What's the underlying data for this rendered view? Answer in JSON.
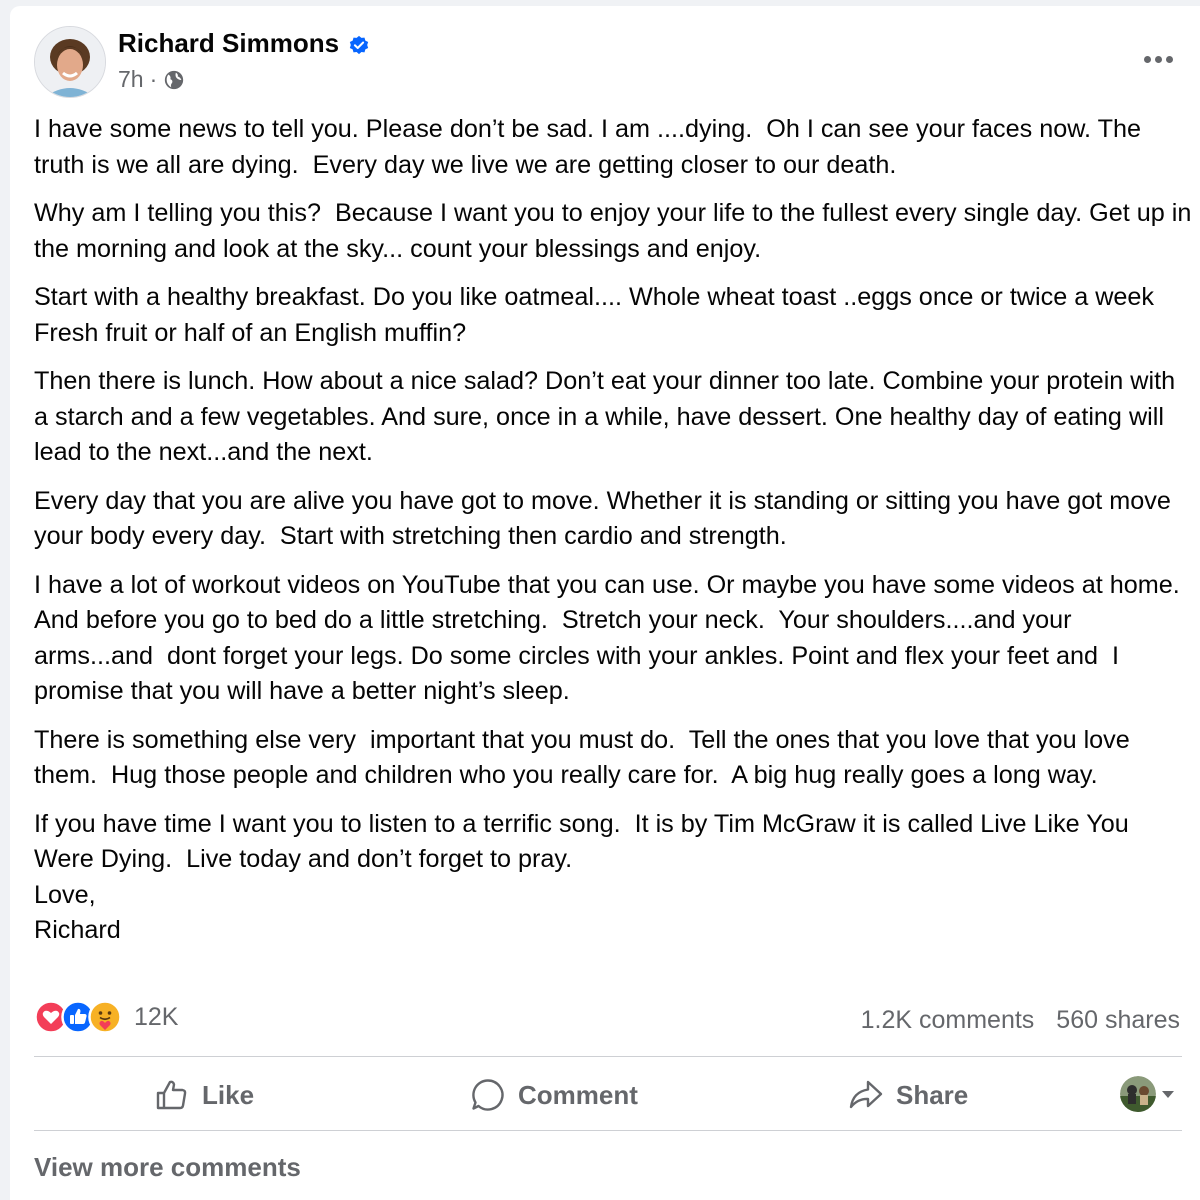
{
  "post": {
    "author": "Richard Simmons",
    "verified_icon": "verified-badge-icon",
    "time": "7h",
    "separator": "·",
    "audience_icon": "globe-icon",
    "more_icon": "more-options-icon",
    "paragraphs": [
      "I have some news to tell you. Please don’t be sad. I am ....dying.  Oh I can see your faces now. The truth is we all are dying.  Every day we live we are getting closer to our death.",
      "Why am I telling you this?  Because I want you to enjoy your life to the fullest every single day. Get up in the morning and look at the sky... count your blessings and enjoy.",
      "Start with a healthy breakfast. Do you like oatmeal.... Whole wheat toast ..eggs once or twice a week   Fresh fruit or half of an English muffin?",
      "Then there is lunch. How about a nice salad? Don’t eat your dinner too late. Combine your protein with a starch and a few vegetables. And sure, once in a while, have dessert. One healthy day of eating will lead to the next...and the next.",
      "Every day that you are alive you have got to move. Whether it is standing or sitting you have got move your body every day.  Start with stretching then cardio and strength.",
      "I have a lot of workout videos on YouTube that you can use. Or maybe you have some videos at home. And before you go to bed do a little stretching.  Stretch your neck.  Your shoulders....and your arms...and  dont forget your legs. Do some circles with your ankles. Point and flex your feet and  I promise that you will have a better night’s sleep.",
      "There is something else very  important that you must do.  Tell the ones that you love that you love them.  Hug those people and children who you really care for.  A big hug really goes a long way.",
      "If you have time I want you to listen to a terrific song.  It is by Tim McGraw it is called Live Like You Were Dying.  Live today and don’t forget to pray.\nLove,\nRichard"
    ]
  },
  "engagement": {
    "reaction_icons": [
      "love-reaction-icon",
      "like-reaction-icon",
      "care-reaction-icon"
    ],
    "reaction_count": "12K",
    "comments": "1.2K comments",
    "shares": "560 shares"
  },
  "actions": {
    "like": "Like",
    "comment": "Comment",
    "share": "Share"
  },
  "footer": {
    "view_more": "View more comments"
  },
  "colors": {
    "brand_blue": "#0866ff",
    "secondary_text": "#65676b",
    "love_red": "#f33e58",
    "care_yellow": "#f7b125"
  }
}
